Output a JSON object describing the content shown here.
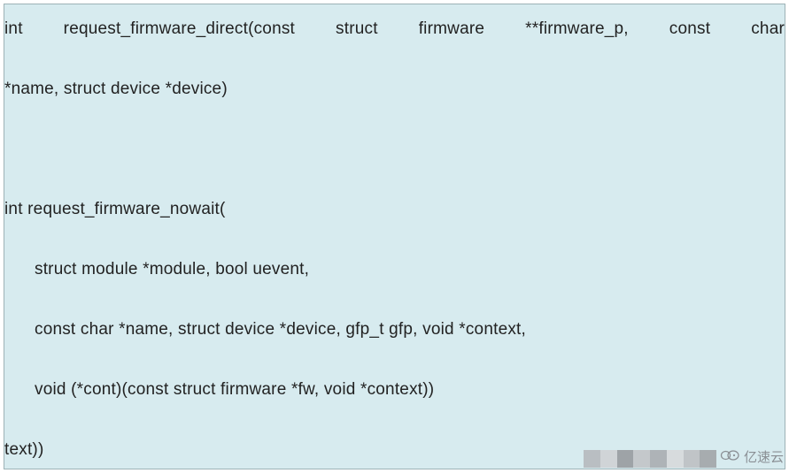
{
  "code": {
    "line1": "int  request_firmware_direct(const  struct  firmware  **firmware_p,  const  char",
    "line2": "*name, struct device *device)",
    "line3": "int request_firmware_nowait(",
    "line4": "struct module *module, bool uevent,",
    "line5": "const char *name, struct device *device, gfp_t gfp, void *context,",
    "line6": "void (*cont)(const struct firmware *fw, void *context))",
    "line7": "text))"
  },
  "watermark": {
    "text": "亿速云"
  }
}
